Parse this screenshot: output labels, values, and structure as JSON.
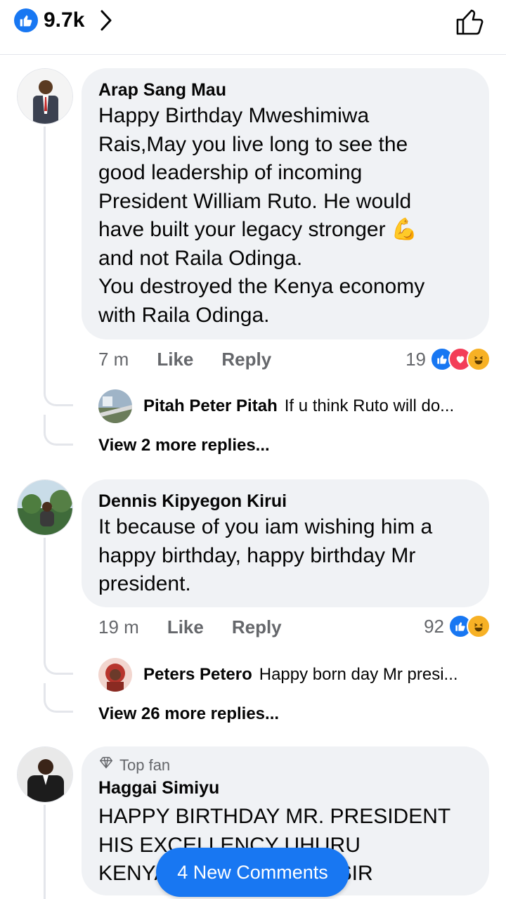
{
  "header": {
    "reaction_count": "9.7k"
  },
  "comments": [
    {
      "author": "Arap Sang Mau",
      "lines": [
        "Happy Birthday Mweshimiwa",
        "Rais,May you live long to see the",
        "good leadership of incoming",
        "President William Ruto. He would",
        "have built your legacy stronger 💪",
        "and not Raila Odinga.",
        "You destroyed the Kenya economy",
        "with Raila Odinga."
      ],
      "time": "7 m",
      "like_label": "Like",
      "reply_label": "Reply",
      "reaction_count": "19",
      "reply_preview": {
        "name": "Pitah Peter Pitah",
        "text": "If u think Ruto will do..."
      },
      "more_replies": "View 2 more replies..."
    },
    {
      "author": "Dennis Kipyegon Kirui",
      "lines": [
        "It because of you iam wishing him a",
        "happy birthday, happy birthday Mr",
        "president."
      ],
      "time": "19 m",
      "like_label": "Like",
      "reply_label": "Reply",
      "reaction_count": "92",
      "reply_preview": {
        "name": "Peters Petero",
        "text": "Happy born day Mr presi..."
      },
      "more_replies": "View 26 more replies..."
    },
    {
      "badge": "Top fan",
      "author": "Haggai Simiyu",
      "lines": [
        "HAPPY BIRTHDAY MR. PRESIDENT",
        "HIS EXCELLENCY UHURU",
        "KENYATTA THANK YOU SIR"
      ]
    }
  ],
  "new_comments_label": "4 New Comments",
  "colors": {
    "facebook_blue": "#1877f2",
    "bubble_bg": "#f0f2f5",
    "muted_text": "#65676b",
    "love_red": "#f33e58",
    "haha_yellow": "#f7b125"
  }
}
